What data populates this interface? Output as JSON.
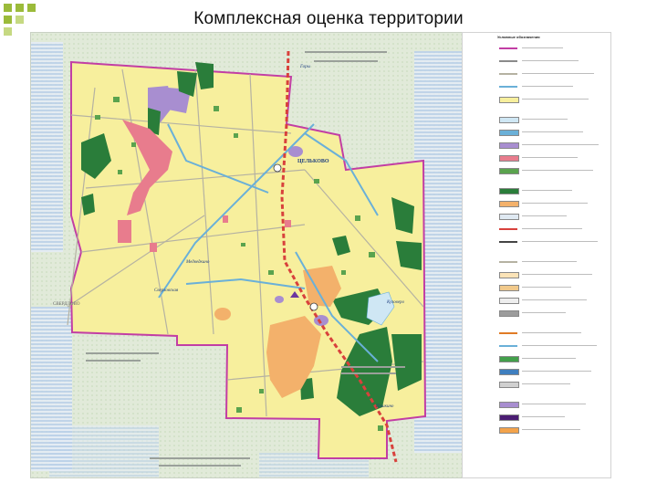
{
  "slide": {
    "title": "Комплексная оценка территории"
  },
  "map": {
    "labels": {
      "town_north": "ЦЕЛЬКОВО",
      "town_west": "СВЕРДЛОВО",
      "road_west": "Сверловская",
      "road_southeast": "Кузоверо",
      "road_southwest": "Медведкино",
      "road_north": "Горы",
      "road_south": "Пушкино"
    },
    "colors": {
      "background": "#e3ecdc",
      "territory": "#f7ef9d",
      "boundary": "#c23ea4",
      "forest_green": "#2a7d3a",
      "mid_green": "#5aa34e",
      "pink_zone": "#e87c8d",
      "orange_zone": "#f3b16b",
      "violet_zone": "#a88ed0",
      "lake": "#cfe7f4",
      "railway": "#d8413c",
      "road_blue": "#6ab0d8",
      "roads_gray": "#b5b2a2"
    }
  },
  "legend": {
    "title": "Условные обозначения",
    "rows": [
      {
        "kind": "line",
        "color": "#c23ea4",
        "label": ""
      },
      {
        "kind": "line",
        "color": "#8a8a8a",
        "label": ""
      },
      {
        "kind": "line",
        "color": "#b5b2a2",
        "label": ""
      },
      {
        "kind": "line",
        "color": "#6ab0d8",
        "label": ""
      },
      {
        "kind": "fill",
        "color": "#f7ef9d",
        "label": ""
      },
      {
        "kind": "fill",
        "color": "#cfe7f4",
        "label": ""
      },
      {
        "kind": "fill",
        "color": "#6ab0d8",
        "label": ""
      },
      {
        "kind": "fill",
        "color": "#a88ed0",
        "label": ""
      },
      {
        "kind": "fill",
        "color": "#e87c8d",
        "label": ""
      },
      {
        "kind": "fill",
        "color": "#5aa34e",
        "label": ""
      },
      {
        "kind": "fill",
        "color": "#2a7d3a",
        "label": ""
      },
      {
        "kind": "fill",
        "color": "#f3b16b",
        "label": ""
      },
      {
        "kind": "fill",
        "color": "#dfe9f2",
        "label": ""
      },
      {
        "kind": "line",
        "color": "#d8413c",
        "label": ""
      },
      {
        "kind": "line",
        "color": "#444444",
        "label": ""
      },
      {
        "kind": "line",
        "color": "#b5b2a2",
        "label": ""
      },
      {
        "kind": "fill",
        "color": "#fbe3b7",
        "label": ""
      },
      {
        "kind": "fill",
        "color": "#f1c98b",
        "label": ""
      },
      {
        "kind": "fill",
        "color": "#eeeeee",
        "label": ""
      },
      {
        "kind": "fill",
        "color": "#9c9c9c",
        "label": ""
      },
      {
        "kind": "line",
        "color": "#e07b25",
        "label": ""
      },
      {
        "kind": "line",
        "color": "#6ab0d8",
        "label": ""
      },
      {
        "kind": "fill",
        "color": "#43a04b",
        "label": ""
      },
      {
        "kind": "fill",
        "color": "#3f7fbf",
        "label": ""
      },
      {
        "kind": "fill",
        "color": "#d0d0d0",
        "label": ""
      },
      {
        "kind": "fill",
        "color": "#a88ed0",
        "label": ""
      },
      {
        "kind": "fill",
        "color": "#4b1d73",
        "label": ""
      },
      {
        "kind": "fill",
        "color": "#f3a34b",
        "label": ""
      }
    ]
  }
}
